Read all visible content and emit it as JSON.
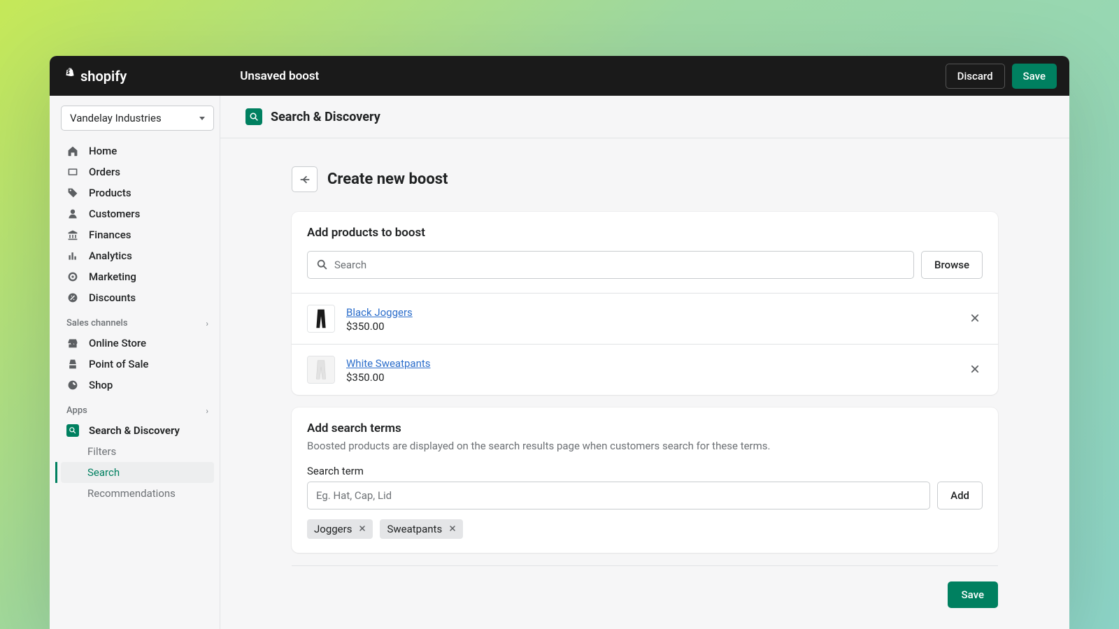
{
  "topbar": {
    "logo_text": "shopify",
    "title": "Unsaved boost",
    "discard": "Discard",
    "save": "Save"
  },
  "store": {
    "name": "Vandelay Industries"
  },
  "nav": {
    "primary": [
      {
        "label": "Home"
      },
      {
        "label": "Orders"
      },
      {
        "label": "Products"
      },
      {
        "label": "Customers"
      },
      {
        "label": "Finances"
      },
      {
        "label": "Analytics"
      },
      {
        "label": "Marketing"
      },
      {
        "label": "Discounts"
      }
    ],
    "sales_header": "Sales channels",
    "sales": [
      {
        "label": "Online Store"
      },
      {
        "label": "Point of Sale"
      },
      {
        "label": "Shop"
      }
    ],
    "apps_header": "Apps",
    "app_name": "Search & Discovery",
    "app_sub": [
      {
        "label": "Filters"
      },
      {
        "label": "Search"
      },
      {
        "label": "Recommendations"
      }
    ]
  },
  "app_header": {
    "title": "Search & Discovery"
  },
  "page": {
    "title": "Create new boost"
  },
  "products_card": {
    "title": "Add products to boost",
    "search_placeholder": "Search",
    "browse": "Browse",
    "items": [
      {
        "name": "Black Joggers",
        "price": "$350.00"
      },
      {
        "name": "White Sweatpants",
        "price": "$350.00"
      }
    ]
  },
  "terms_card": {
    "title": "Add search terms",
    "desc": "Boosted products are displayed on the search results page when customers search for these terms.",
    "field_label": "Search term",
    "placeholder": "Eg. Hat, Cap, Lid",
    "add": "Add",
    "tags": [
      "Joggers",
      "Sweatpants"
    ]
  },
  "footer": {
    "save": "Save"
  }
}
